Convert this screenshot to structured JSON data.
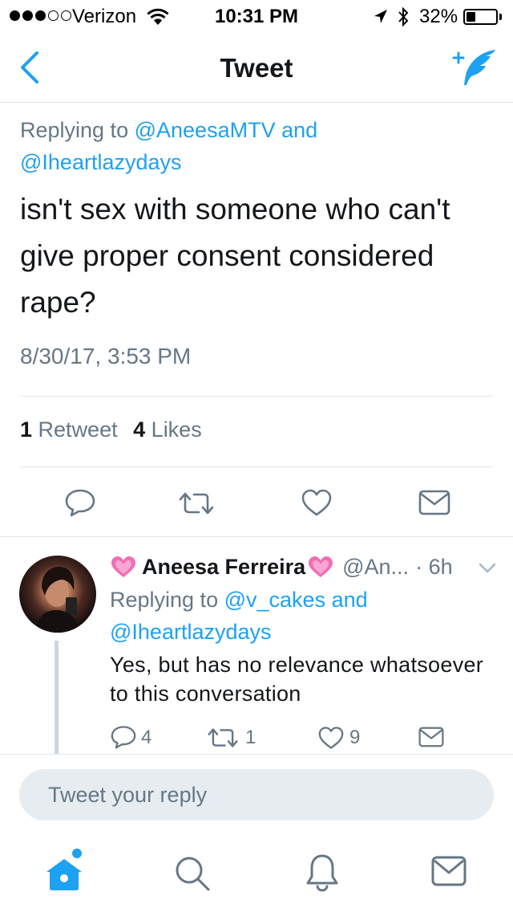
{
  "status_bar": {
    "carrier": "Verizon",
    "time": "10:31 PM",
    "battery": "32%",
    "signal_bars_filled": 3,
    "signal_bars_total": 5
  },
  "nav": {
    "title": "Tweet",
    "back_icon": "chevron-left-icon",
    "compose_icon": "compose-feather-icon"
  },
  "tweet": {
    "replying_prefix": "Replying to",
    "mention_1": "@AneesaMTV",
    "replying_and": "and",
    "mention_2": "@Iheartlazydays",
    "text": "isn't sex with someone who can't give proper consent considered rape?",
    "timestamp": "8/30/17, 3:53 PM",
    "retweet_count": "1",
    "retweet_label": "Retweet",
    "like_count": "4",
    "like_label": "Likes"
  },
  "reply": {
    "name": "Aneesa Ferreira",
    "handle": "@An...",
    "time": "· 6h",
    "replying_prefix": "Replying to",
    "mention_1": "@v_cakes",
    "replying_and": "and",
    "mention_2": "@Iheartlazydays",
    "text": "Yes, but has no relevance whatsoever to this conversation",
    "reply_count": "4",
    "retweet_count": "1",
    "like_count": "9"
  },
  "compose": {
    "placeholder": "Tweet your reply"
  },
  "tabbar": {
    "items": [
      "home-icon",
      "search-icon",
      "notifications-icon",
      "messages-icon"
    ]
  },
  "colors": {
    "accent": "#1da1f2",
    "secondary_text": "#657786",
    "divider": "#e1e8ed"
  }
}
